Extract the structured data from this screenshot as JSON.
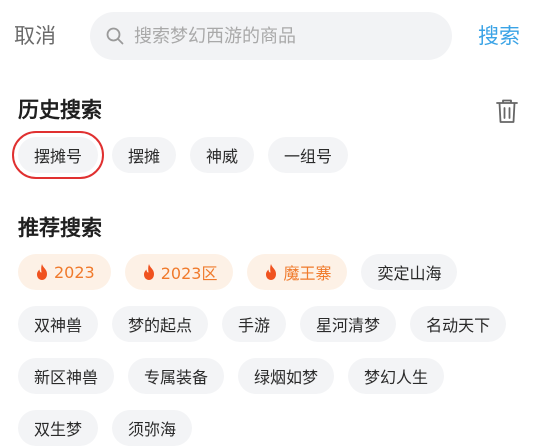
{
  "topbar": {
    "cancel_label": "取消",
    "search_placeholder": "搜索梦幻西游的商品",
    "search_value": "",
    "search_button_label": "搜索"
  },
  "history": {
    "title": "历史搜索",
    "items": [
      "摆摊号",
      "摆摊",
      "神威",
      "一组号"
    ],
    "highlighted_index": 0
  },
  "recommend": {
    "title": "推荐搜索",
    "hot_items": [
      "2023",
      "2023区",
      "魔王寨"
    ],
    "items": [
      "奕定山海",
      "双神兽",
      "梦的起点",
      "手游",
      "星河清梦",
      "名动天下",
      "新区神兽",
      "专属装备",
      "绿烟如梦",
      "梦幻人生",
      "双生梦",
      "须弥海"
    ]
  },
  "colors": {
    "accent": "#3aa3e6",
    "hot_text": "#f07a2c",
    "hot_bg": "#fdf1e6",
    "chip_bg": "#f3f4f6",
    "highlight_border": "#e03030"
  },
  "icons": {
    "search": "search-icon",
    "trash": "trash-icon",
    "fire": "fire-icon"
  }
}
